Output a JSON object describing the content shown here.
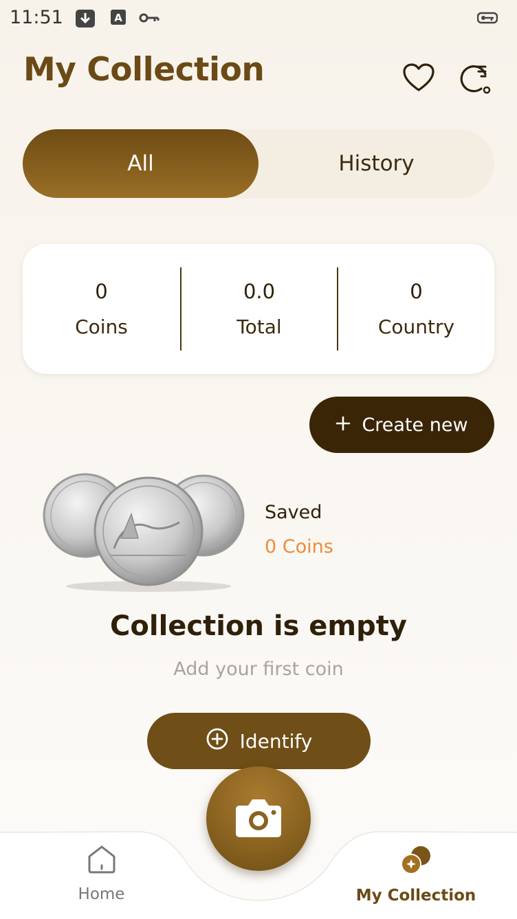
{
  "status_bar": {
    "time": "11:51",
    "icons": [
      "download-box-icon",
      "translate-icon",
      "key-icon",
      "vpn-key-icon"
    ]
  },
  "header": {
    "title": "My Collection",
    "icons": [
      "heart-icon",
      "sort-icon"
    ]
  },
  "tabs": [
    {
      "label": "All",
      "active": true
    },
    {
      "label": "History",
      "active": false
    }
  ],
  "stats": [
    {
      "value": "0",
      "label": "Coins"
    },
    {
      "value": "0.0",
      "label": "Total"
    },
    {
      "value": "0",
      "label": "Country"
    }
  ],
  "create_button": {
    "label": "Create new",
    "icon": "plus-icon"
  },
  "folder": {
    "title": "Saved",
    "count": "0 Coins"
  },
  "empty_state": {
    "title": "Collection is empty",
    "subtitle": "Add your first coin",
    "button_label": "Identify",
    "button_icon": "plus-circle-icon"
  },
  "bottom_nav": {
    "items": [
      {
        "label": "Home",
        "icon": "home-icon",
        "active": false
      },
      {
        "label": "My Collection",
        "icon": "coins-icon",
        "active": true
      }
    ],
    "camera_icon": "camera-icon"
  },
  "colors": {
    "accent": "#6f4e17",
    "dark": "#3b2507",
    "highlight": "#f08a3c",
    "muted": "#a9a49b"
  }
}
